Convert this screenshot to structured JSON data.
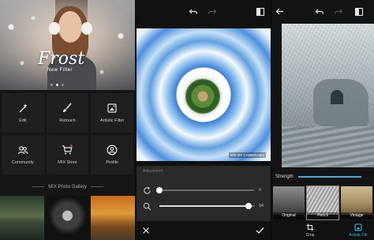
{
  "home": {
    "banner": {
      "title": "Frost",
      "subtitle": "New Filter"
    },
    "tiles": [
      {
        "label": "Edit",
        "icon": "magic-wand-icon"
      },
      {
        "label": "Retouch",
        "icon": "brush-icon"
      },
      {
        "label": "Artistic Filter",
        "icon": "palette-icon"
      },
      {
        "label": "Community",
        "icon": "people-icon"
      },
      {
        "label": "MIX Store",
        "icon": "cart-icon"
      },
      {
        "label": "Profile",
        "icon": "profile-icon"
      }
    ],
    "gallery_label": "MIX Photo Gallery"
  },
  "editor": {
    "adjust_caption": "Adjustment",
    "sliders": [
      {
        "icon": "rotate-icon",
        "value": "0",
        "fraction": 0.0
      },
      {
        "icon": "zoom-icon",
        "value": "94",
        "fraction": 0.94
      }
    ],
    "watermark": "MIX BY CAMERA360"
  },
  "artistic": {
    "strength_label": "Strength",
    "strength_fraction": 0.0,
    "filters": [
      {
        "label": "Original"
      },
      {
        "label": "Pencil"
      },
      {
        "label": "Vintage"
      }
    ],
    "bottom_tabs": [
      {
        "label": "Crop"
      },
      {
        "label": "Artistic Filt"
      }
    ],
    "accent_color": "#3db0e0"
  }
}
